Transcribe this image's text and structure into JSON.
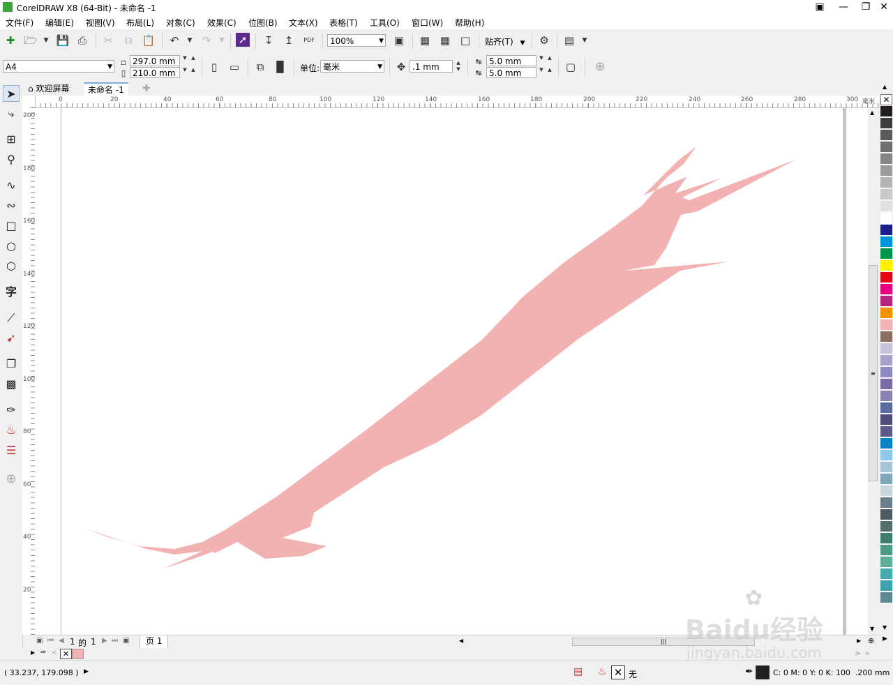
{
  "app": {
    "title": "CorelDRAW X8 (64-Bit) - 未命名 -1"
  },
  "menu": [
    "文件(F)",
    "编辑(E)",
    "视图(V)",
    "布局(L)",
    "对象(C)",
    "效果(C)",
    "位图(B)",
    "文本(X)",
    "表格(T)",
    "工具(O)",
    "窗口(W)",
    "帮助(H)"
  ],
  "standard_toolbar": {
    "zoom": "100%",
    "snap_label": "贴齐(T)"
  },
  "property_bar": {
    "page_size": "A4",
    "width": "297.0 mm",
    "height": "210.0 mm",
    "units_label": "单位:",
    "units_value": "毫米",
    "nudge": ".1 mm",
    "dup_x": "5.0 mm",
    "dup_y": "5.0 mm"
  },
  "tabs": [
    "欢迎屏幕",
    "未命名 -1"
  ],
  "rulers": {
    "top": [
      "0",
      "20",
      "40",
      "60",
      "80",
      "100",
      "120",
      "140",
      "160",
      "180",
      "200",
      "220",
      "240",
      "260",
      "280",
      "300"
    ],
    "top_units": "毫米",
    "left": [
      "200",
      "180",
      "160",
      "140",
      "120",
      "100",
      "80",
      "60",
      "40",
      "20"
    ]
  },
  "page_nav": {
    "current": "1",
    "of_label": "的",
    "total": "1",
    "page_tab": "页 1"
  },
  "palette": [
    "#231f20",
    "#3d3d3d",
    "#595959",
    "#6f6f6f",
    "#868686",
    "#9c9c9c",
    "#b3b3b3",
    "#c9c9c9",
    "#e0e0e0",
    "#ffffff",
    "#1b1f8a",
    "#0093dd",
    "#00964a",
    "#fff200",
    "#e30613",
    "#e6007e",
    "#b5247d",
    "#f39200",
    "#f4b2b2",
    "#8c6e63",
    "#c6c3dd",
    "#a7a3cc",
    "#8e8bc0",
    "#7a6aa8",
    "#8b84b3",
    "#5b6a9f",
    "#4e4d7b",
    "#5f5a8c",
    "#0a83c6",
    "#8fc8ea",
    "#a6c5d6",
    "#7fa7b9",
    "#c9d6de",
    "#6b7d89",
    "#4d5963",
    "#546e6a",
    "#3e7e6e",
    "#4d9a84",
    "#5fae9a",
    "#44aaaa",
    "#3ea3b0",
    "#5d8a92"
  ],
  "doc_palette": [
    "none",
    "#f4b2b2"
  ],
  "status": {
    "cursor": "( 33.237, 179.098 )",
    "fill_label": "无",
    "outline": "C: 0 M: 0 Y: 0 K: 100  .200 mm"
  },
  "shape_color": "#f2b2b2",
  "watermark": {
    "line1": "Baidu经验",
    "line2": "jingyan.baidu.com"
  }
}
